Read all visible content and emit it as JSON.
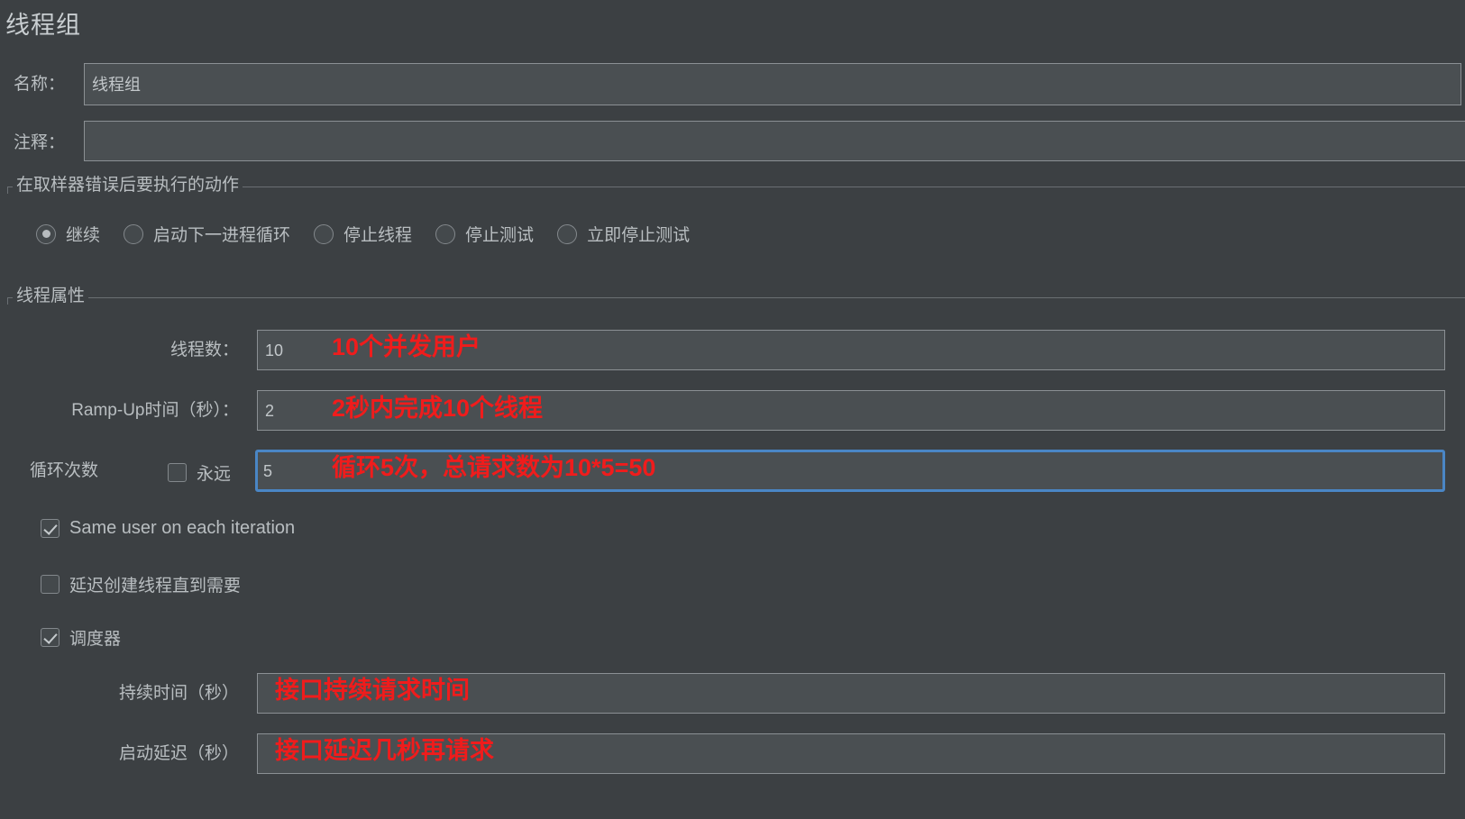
{
  "page": {
    "title": "线程组"
  },
  "name_field": {
    "label": "名称：",
    "value": "线程组"
  },
  "comment_field": {
    "label": "注释：",
    "value": ""
  },
  "on_sampler_error": {
    "group_title": "在取样器错误后要执行的动作",
    "options": [
      {
        "label": "继续",
        "selected": true
      },
      {
        "label": "启动下一进程循环",
        "selected": false
      },
      {
        "label": "停止线程",
        "selected": false
      },
      {
        "label": "停止测试",
        "selected": false
      },
      {
        "label": "立即停止测试",
        "selected": false
      }
    ]
  },
  "thread_properties": {
    "group_title": "线程属性",
    "num_threads": {
      "label": "线程数：",
      "value": "10",
      "annotation": "10个并发用户"
    },
    "ramp_up": {
      "label": "Ramp-Up时间（秒）：",
      "value": "2",
      "annotation": "2秒内完成10个线程"
    },
    "loop_count": {
      "label": "循环次数",
      "forever_label": "永远",
      "forever_checked": false,
      "value": "5",
      "annotation": "循环5次，总请求数为10*5=50",
      "focused": true
    },
    "same_user": {
      "label": "Same user on each iteration",
      "checked": true
    },
    "delayed_start": {
      "label": "延迟创建线程直到需要",
      "checked": false
    },
    "scheduler": {
      "label": "调度器",
      "checked": true
    },
    "duration": {
      "label": "持续时间（秒）",
      "value": "",
      "annotation": "接口持续请求时间"
    },
    "startup_delay": {
      "label": "启动延迟（秒）",
      "value": "",
      "annotation": "接口延迟几秒再请求"
    }
  },
  "colors": {
    "background": "#3c4043",
    "field_background": "#4a4f52",
    "field_border": "#8b9094",
    "focus_border": "#4a86c5",
    "text": "#b9bec1",
    "annotation_red": "#f01c1c"
  }
}
